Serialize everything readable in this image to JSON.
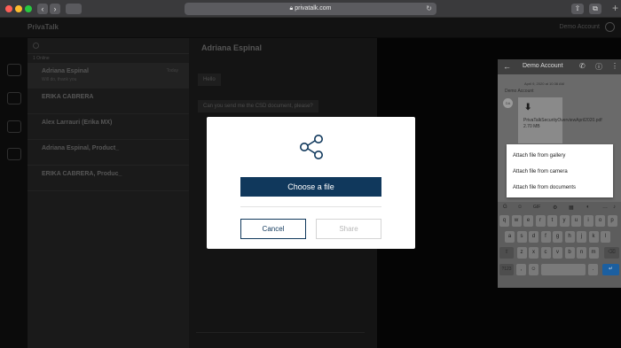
{
  "browser": {
    "url": "privatalk.com"
  },
  "app": {
    "logo": "PrivaTalk",
    "account": "Demo Account"
  },
  "conversations": {
    "online_label": "1 Online",
    "items": [
      {
        "name": "Adriana Espinal",
        "preview": "Will do, thank you",
        "time": "Today"
      },
      {
        "name": "ERIKA CABRERA",
        "preview": "",
        "time": ""
      },
      {
        "name": "Alex Larrauri (Erika MX)",
        "preview": "",
        "time": ""
      },
      {
        "name": "Adriana Espinal,  Product_",
        "preview": "",
        "time": ""
      },
      {
        "name": "ERIKA CABRERA,  Produc_",
        "preview": "",
        "time": ""
      }
    ]
  },
  "chat": {
    "title": "Adriana Espinal",
    "messages": [
      "Hello",
      "Can you send me the CSD document, please?"
    ]
  },
  "phone": {
    "title": "Demo Account",
    "date": "April 9, 2020 at 10:38 AM",
    "sender": "Demo Account",
    "avatar": "DA",
    "file_name": "PrivaTalkSecurityOverviewApril2020.pdf 2.70 MB",
    "attach_options": [
      "Attach file from gallery",
      "Attach file from camera",
      "Attach file from documents"
    ],
    "keyboard_rows": [
      [
        "q",
        "w",
        "e",
        "r",
        "t",
        "y",
        "u",
        "i",
        "o",
        "p"
      ],
      [
        "a",
        "s",
        "d",
        "f",
        "g",
        "h",
        "j",
        "k",
        "l"
      ],
      [
        "z",
        "x",
        "c",
        "v",
        "b",
        "n",
        "m"
      ]
    ],
    "strip_gif": "GIF",
    "key_123": "?123",
    "key_comma": ",",
    "key_period": "."
  },
  "modal": {
    "choose_label": "Choose a file",
    "cancel_label": "Cancel",
    "share_label": "Share"
  }
}
